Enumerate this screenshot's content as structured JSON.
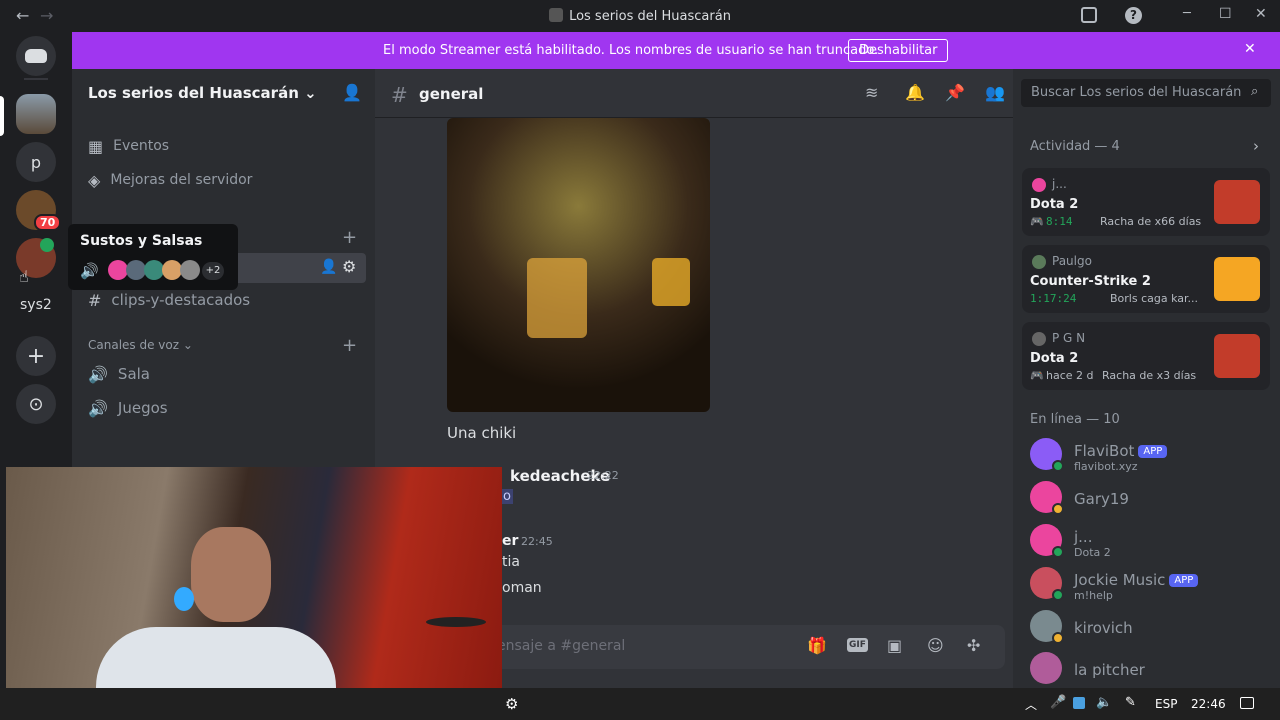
{
  "window": {
    "title": "Los serios del Huascarán",
    "back": "←",
    "forward": "→",
    "min": "─",
    "max": "☐",
    "close": "✕",
    "inbox": "⬛",
    "help": "?"
  },
  "banner": {
    "text": "El modo Streamer está habilitado. Los nombres de usuario se han truncado.",
    "button": "Deshabilitar",
    "close": "✕"
  },
  "rail": {
    "server_p": "p",
    "badge": "70",
    "label": "sys2",
    "add": "+",
    "explore": "⊙"
  },
  "server": {
    "name": "Los serios del Huascarán",
    "chevron": "⌄"
  },
  "sidebar": {
    "items": [
      {
        "icon": "calendar",
        "label": "Eventos"
      },
      {
        "icon": "boost",
        "label": "Mejoras del servidor"
      }
    ],
    "tooltip": {
      "title": "Sustos y Salsas",
      "more": "+2"
    },
    "text_channel": "clips-y-destacados",
    "voice_header": "Canales de voz",
    "voice_channels": [
      "Sala",
      "Juegos"
    ]
  },
  "chat": {
    "channel": "general",
    "caption": "Una chiki",
    "author1": "kedeacheke",
    "time1": "22:22",
    "frag1": "o",
    "author2": "er",
    "time2": "22:45",
    "line1": "tia",
    "line2": "oman",
    "placeholder": "ensaje a #general",
    "gif": "GIF"
  },
  "search": {
    "placeholder": "Buscar Los serios del Huascarán"
  },
  "activity": {
    "header": "Actividad — 4",
    "cards": [
      {
        "user": "j...",
        "game": "Dota 2",
        "time": "8:14",
        "extra": "Racha de x66 días",
        "color": "#c23c2a"
      },
      {
        "user": "Paulgo",
        "game": "Counter-Strike 2",
        "time": "1:17:24",
        "extra": "Borls caga kar...",
        "color": "#f5a623"
      },
      {
        "user": "P G N",
        "game": "Dota 2",
        "time": "hace 2 d",
        "extra": "Racha de x3 días",
        "color": "#c23c2a"
      }
    ]
  },
  "online": {
    "header": "En línea — 10",
    "members": [
      {
        "name": "FlaviBot",
        "app": "APP",
        "sub": "flavibot.xyz",
        "color": "#8b5cf6"
      },
      {
        "name": "Gary19",
        "app": "",
        "sub": "",
        "color": "#eb459e"
      },
      {
        "name": "j...",
        "app": "",
        "sub": "Dota 2",
        "color": "#eb459e"
      },
      {
        "name": "Jockie Music",
        "app": "APP",
        "sub": "m!help",
        "color": "#c94f5e"
      },
      {
        "name": "kirovich",
        "app": "",
        "sub": "",
        "color": "#7a8a8f"
      },
      {
        "name": "la pitcher",
        "app": "",
        "sub": "",
        "color": "#b05c9a"
      }
    ]
  },
  "taskbar": {
    "lang": "ESP",
    "time": "22:46"
  },
  "colors": {
    "accent": "#5865f2",
    "banner": "#a036f0",
    "online": "#23a55a",
    "idle": "#f0b232"
  }
}
